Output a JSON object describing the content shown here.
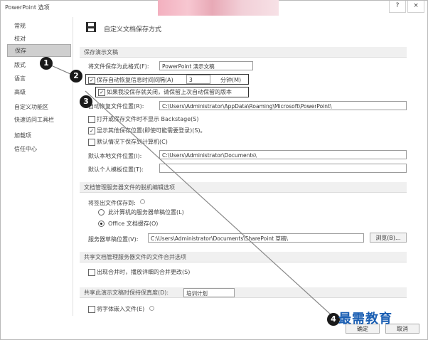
{
  "window": {
    "title": "PowerPoint 选项",
    "help_glyph": "?",
    "close_glyph": "×"
  },
  "sidebar": {
    "items": [
      {
        "label": "常规"
      },
      {
        "label": "校对"
      },
      {
        "label": "保存"
      },
      {
        "label": "版式"
      },
      {
        "label": "语言"
      },
      {
        "label": "高级"
      },
      {
        "label": "自定义功能区"
      },
      {
        "label": "快速访问工具栏"
      },
      {
        "label": "加载项"
      },
      {
        "label": "信任中心"
      }
    ]
  },
  "header": {
    "title": "自定义文档保存方式"
  },
  "sections": {
    "save_presentations": "保存演示文稿",
    "offline_editing": "文档管理服务器文件的脱机编辑选项",
    "merge": "共享文档管理服务器文件的文件合并选项",
    "fidelity": "共享此演示文稿时保持保真度(D):"
  },
  "save": {
    "format_label": "将文件保存为此格式(F):",
    "format_value": "PowerPoint 演示文稿",
    "autorecover_label": "保存自动恢复信息时间间隔(A)",
    "autorecover_minutes": "3",
    "minutes_unit": "分钟(M)",
    "keep_last_label": "如果我没保存就关闭，请保留上次自动保留的版本",
    "autorecover_location_label": "自动恢复文件位置(R):",
    "autorecover_location_value": "C:\\Users\\Administrator\\AppData\\Roaming\\Microsoft\\PowerPoint\\",
    "no_backstage_label": "打开或保存文件时不显示 Backstage(S)",
    "show_additional_label": "显示其他保存位置(即使可能需要登录)(S)。",
    "default_computer_label": "默认情况下保存到计算机(C)",
    "local_location_label": "默认本地文件位置(I):",
    "local_location_value": "C:\\Users\\Administrator\\Documents\\",
    "personal_templates_label": "默认个人模板位置(T):",
    "personal_templates_value": ""
  },
  "offline": {
    "save_to_label": "将签出文件保存到:",
    "option_server": "此计算机的服务器草稿位置(L)",
    "option_office": "Office 文档缓存(O)",
    "drafts_label": "服务器草稿位置(V):",
    "drafts_value": "C:\\Users\\Administrator\\Documents\\SharePoint 草稿\\",
    "browse_label": "浏览(B)..."
  },
  "merge": {
    "show_changes_label": "出现合并时，播放详细的合并更改(S)"
  },
  "fidelity": {
    "file_value": "培训计划",
    "embed_fonts_label": "将字体嵌入文件(E)"
  },
  "footer": {
    "ok_label": "确定",
    "cancel_label": "取消"
  },
  "annotations": {
    "step1": "1",
    "step2": "2",
    "step3": "3",
    "step4": "4"
  },
  "watermark": "最需教育",
  "colors": {
    "accent_blue": "#1b5fb3",
    "badge": "#1a1a1a",
    "active_item": "#cfcfcf"
  }
}
